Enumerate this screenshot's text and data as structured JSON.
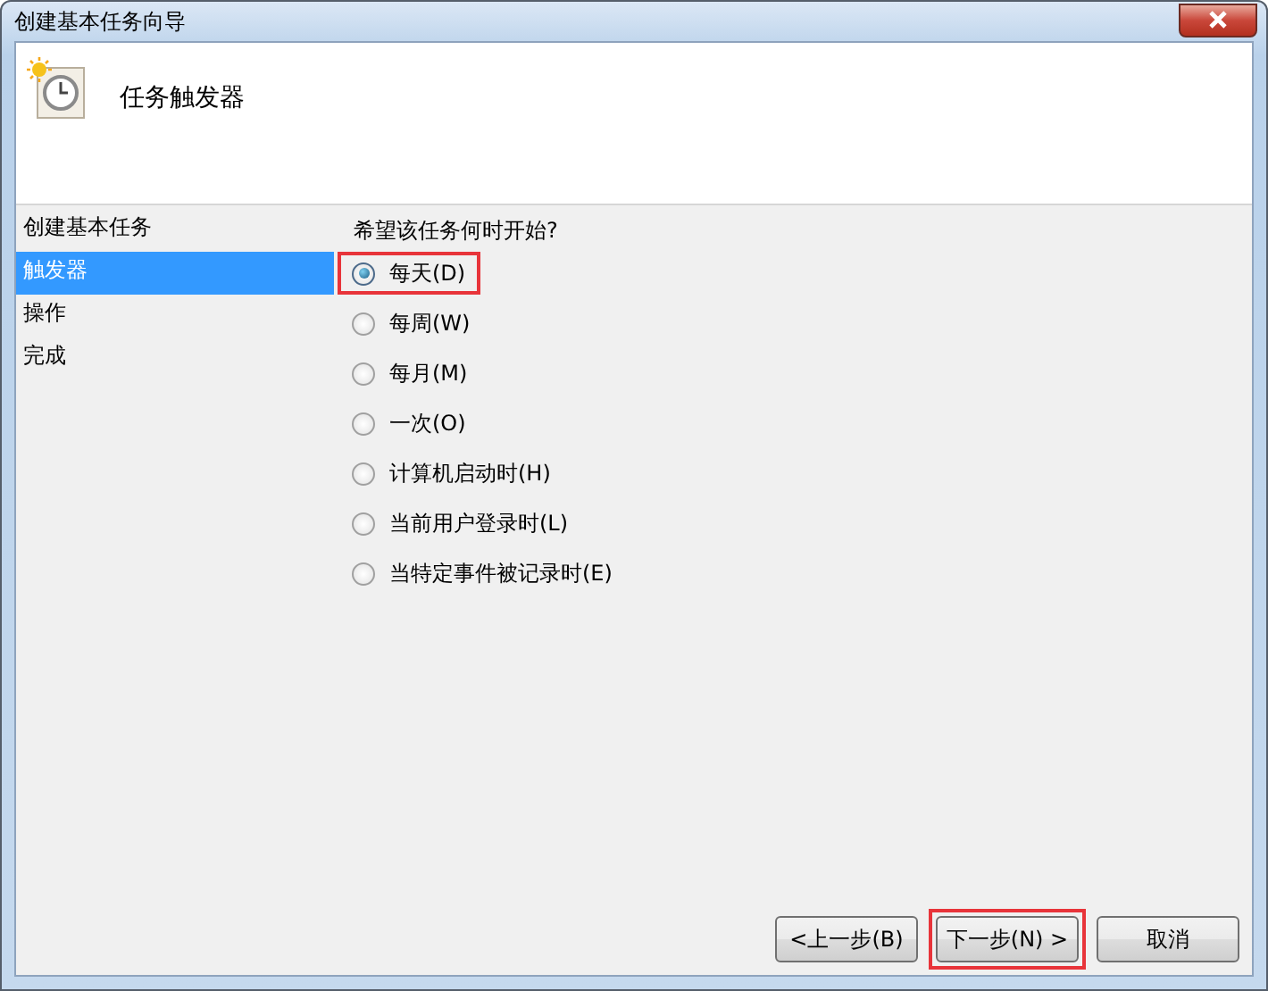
{
  "window": {
    "title": "创建基本任务向导"
  },
  "header": {
    "title": "任务触发器"
  },
  "sidebar": {
    "items": [
      {
        "label": "创建基本任务",
        "selected": false
      },
      {
        "label": "触发器",
        "selected": true
      },
      {
        "label": "操作",
        "selected": false
      },
      {
        "label": "完成",
        "selected": false
      }
    ]
  },
  "question": "希望该任务何时开始?",
  "options": [
    {
      "label": "每天(D)",
      "selected": true,
      "highlighted": true
    },
    {
      "label": "每周(W)",
      "selected": false,
      "highlighted": false
    },
    {
      "label": "每月(M)",
      "selected": false,
      "highlighted": false
    },
    {
      "label": "一次(O)",
      "selected": false,
      "highlighted": false
    },
    {
      "label": "计算机启动时(H)",
      "selected": false,
      "highlighted": false
    },
    {
      "label": "当前用户登录时(L)",
      "selected": false,
      "highlighted": false
    },
    {
      "label": "当特定事件被记录时(E)",
      "selected": false,
      "highlighted": false
    }
  ],
  "buttons": [
    {
      "label": "<上一步(B)",
      "highlighted": false
    },
    {
      "label": "下一步(N) >",
      "highlighted": true
    },
    {
      "label": "取消",
      "highlighted": false
    }
  ]
}
